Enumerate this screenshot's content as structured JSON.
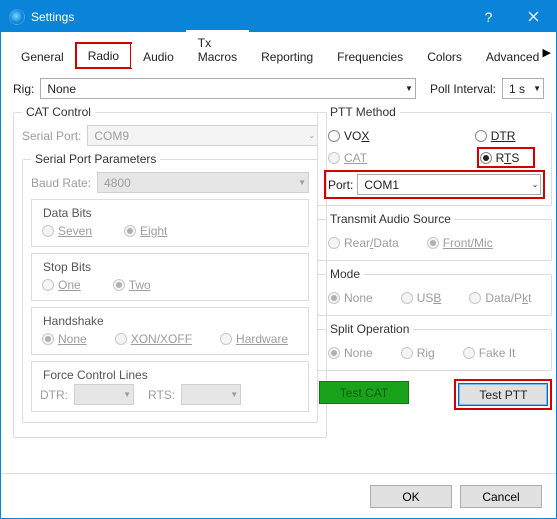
{
  "window": {
    "title": "Settings"
  },
  "tabs": {
    "items": [
      "General",
      "Radio",
      "Audio",
      "Tx Macros",
      "Reporting",
      "Frequencies",
      "Colors",
      "Advanced"
    ],
    "active": 1
  },
  "top": {
    "rig_label": "Rig:",
    "rig_value": "None",
    "poll_label": "Poll Interval:",
    "poll_value": "1 s"
  },
  "cat": {
    "legend": "CAT Control",
    "serial_port_label": "Serial Port:",
    "serial_port_value": "COM9",
    "spp_legend": "Serial Port Parameters",
    "baud_label": "Baud Rate:",
    "baud_value": "4800",
    "databits_legend": "Data Bits",
    "seven": "Seven",
    "eight": "Eight",
    "stopbits_legend": "Stop Bits",
    "one": "One",
    "two": "Two",
    "handshake_legend": "Handshake",
    "hs_none": "None",
    "hs_xon": "XON/XOFF",
    "hs_hw": "Hardware",
    "fcl_legend": "Force Control Lines",
    "dtr": "DTR:",
    "rts": "RTS:"
  },
  "ptt": {
    "legend": "PTT Method",
    "vox": "VOX",
    "dtr": "DTR",
    "cat": "CAT",
    "rts": "RTS",
    "port_label": "Port:",
    "port_value": "COM1"
  },
  "tas": {
    "legend": "Transmit Audio Source",
    "rear": "Rear/Data",
    "front": "Front/Mic"
  },
  "mode": {
    "legend": "Mode",
    "none": "None",
    "usb": "USB",
    "data": "Data/Pkt"
  },
  "split": {
    "legend": "Split Operation",
    "none": "None",
    "rig": "Rig",
    "fake": "Fake It"
  },
  "buttons": {
    "testcat": "Test CAT",
    "testptt": "Test PTT",
    "ok": "OK",
    "cancel": "Cancel"
  }
}
